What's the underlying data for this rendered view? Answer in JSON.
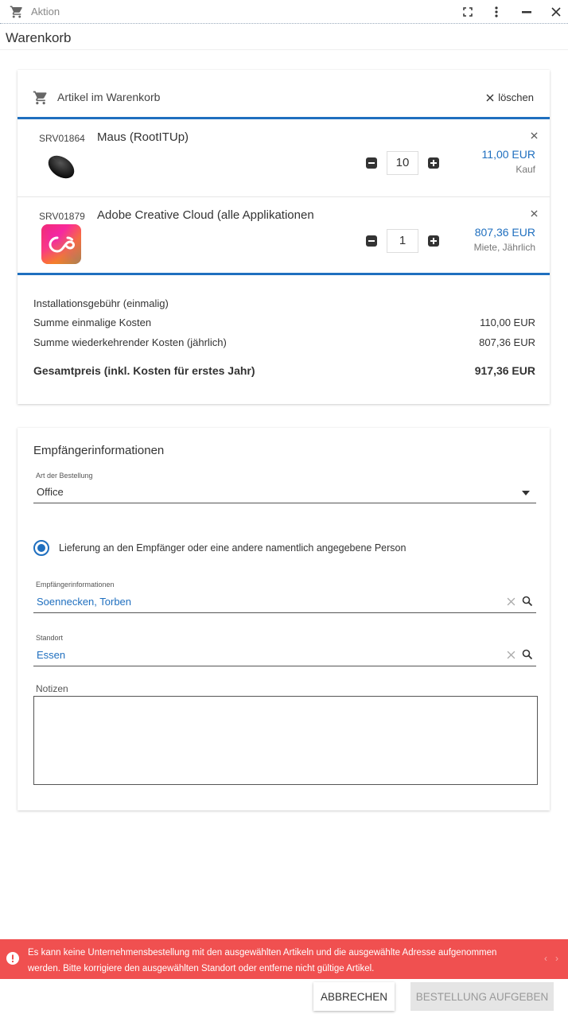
{
  "window": {
    "title": "Aktion",
    "icon": "cart-icon",
    "controls": [
      "fullscreen-icon",
      "more-vert-icon",
      "minimize-icon",
      "close-icon"
    ]
  },
  "page": {
    "heading": "Warenkorb"
  },
  "cart": {
    "header_label": "Artikel im Warenkorb",
    "clear_label": "löschen",
    "items": [
      {
        "code": "SRV01864",
        "name": "Maus (RootITUp)",
        "quantity": "10",
        "price": "11,00 EUR",
        "price_type": "Kauf",
        "icon": "mouse-image"
      },
      {
        "code": "SRV01879",
        "name": "Adobe Creative Cloud (alle Applikationen",
        "quantity": "1",
        "price": "807,36 EUR",
        "price_type": "Miete, Jährlich",
        "icon": "creative-cloud-logo"
      }
    ],
    "totals": [
      {
        "label": "Installationsgebühr (einmalig)",
        "value": ""
      },
      {
        "label": "Summe einmalige Kosten",
        "value": "110,00 EUR"
      },
      {
        "label": "Summe wiederkehrender Kosten (jährlich)",
        "value": "807,36 EUR"
      }
    ],
    "grand_total": {
      "label": "Gesamtpreis (inkl. Kosten für erstes Jahr)",
      "value": "917,36 EUR"
    }
  },
  "recipient": {
    "section_title": "Empfängerinformationen",
    "order_type": {
      "label": "Art der Bestellung",
      "value": "Office"
    },
    "delivery_option": {
      "label": "Lieferung an den Empfänger oder eine andere namentlich angegebene Person",
      "selected": true
    },
    "recipient_field": {
      "label": "Empfängerinformationen",
      "value": "Soennecken, Torben"
    },
    "location_field": {
      "label": "Standort",
      "value": "Essen"
    },
    "notes": {
      "label": "Notizen",
      "value": ""
    }
  },
  "error": {
    "message": "Es kann keine Unternehmensbestellung mit den ausgewählten Artikeln und die ausgewählte Adresse aufgenommen werden. Bitte korrigiere den ausgewählten Standort oder entferne nicht gültige Artikel.",
    "prev": "‹",
    "next": "›"
  },
  "colors": {
    "accent": "#1f6fbf",
    "error": "#f05050"
  },
  "actions": {
    "cancel": "ABBRECHEN",
    "submit": "BESTELLUNG AUFGEBEN"
  }
}
